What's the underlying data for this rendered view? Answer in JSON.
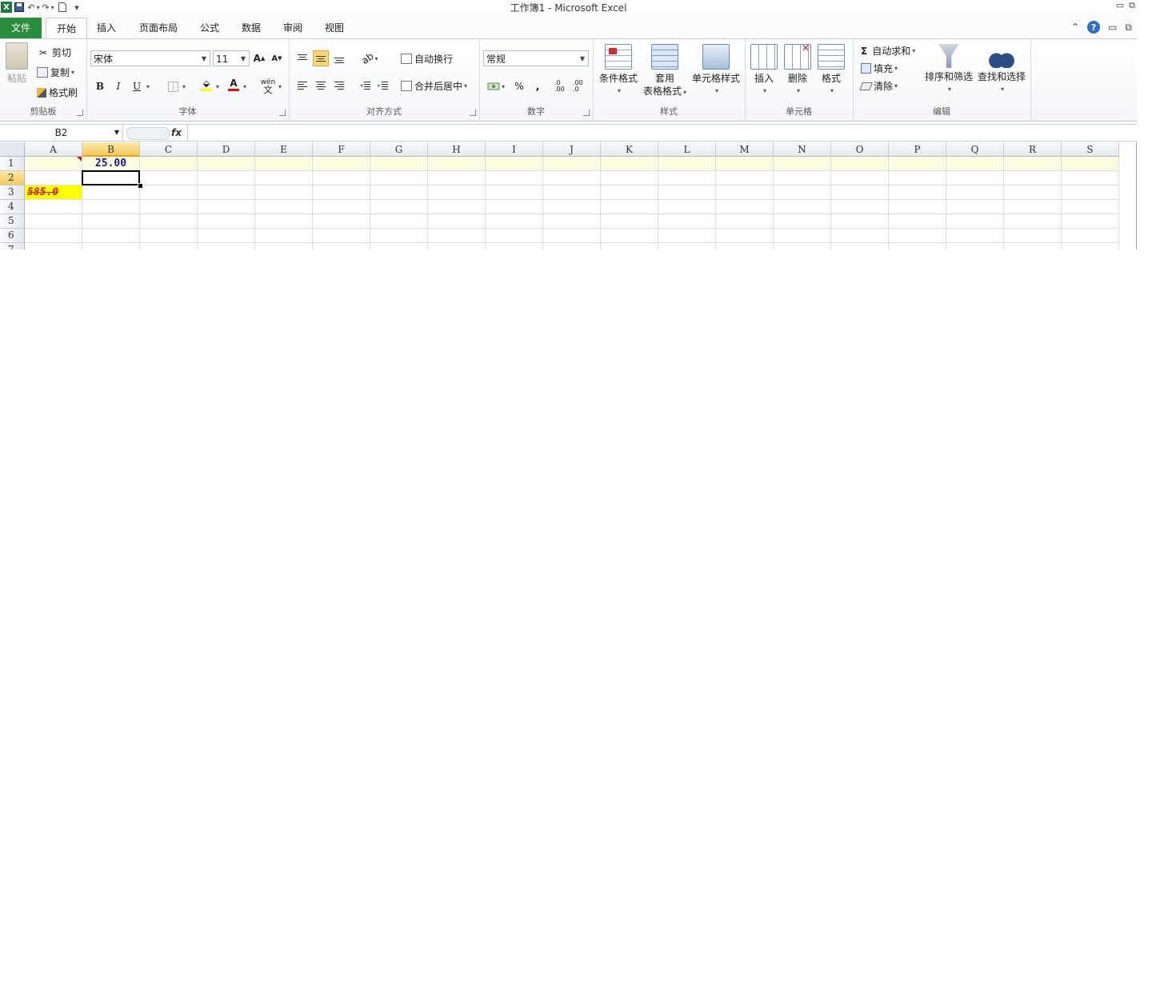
{
  "window": {
    "title": "工作簿1 - Microsoft Excel",
    "app_icon": "excel-icon"
  },
  "tabs": {
    "file": "文件",
    "items": [
      "开始",
      "插入",
      "页面布局",
      "公式",
      "数据",
      "审阅",
      "视图"
    ],
    "active": "开始"
  },
  "ribbon": {
    "clipboard": {
      "label": "剪贴板",
      "paste": "粘贴",
      "cut": "剪切",
      "copy": "复制",
      "format_painter": "格式刷"
    },
    "font": {
      "label": "字体",
      "font_name": "宋体",
      "font_size": "11",
      "bold": "B",
      "italic": "I",
      "underline": "U",
      "grow": "A",
      "shrink": "A",
      "font_color": "A",
      "phonetic": "wén"
    },
    "alignment": {
      "label": "对齐方式",
      "wrap_text": "自动换行",
      "merge_center": "合并后居中"
    },
    "number": {
      "label": "数字",
      "format": "常规",
      "percent": "%",
      "comma": ",",
      "inc_decimal": ".0 .00",
      "dec_decimal": ".00 .0"
    },
    "styles": {
      "label": "样式",
      "conditional": "条件格式",
      "table_line1": "套用",
      "table_line2": "表格格式",
      "cell_styles": "单元格样式"
    },
    "cells": {
      "label": "单元格",
      "insert": "插入",
      "delete": "删除",
      "format": "格式"
    },
    "editing": {
      "label": "编辑",
      "autosum": "自动求和",
      "sigma": "Σ",
      "fill": "填充",
      "clear": "清除",
      "sort_filter": "排序和筛选",
      "find_select": "查找和选择"
    }
  },
  "formula_bar": {
    "name_box": "B2",
    "fx": "fx",
    "content": ""
  },
  "sheet": {
    "columns": [
      "A",
      "B",
      "C",
      "D",
      "E",
      "F",
      "G",
      "H",
      "I",
      "J",
      "K",
      "L",
      "M",
      "N",
      "O",
      "P",
      "Q",
      "R",
      "S"
    ],
    "rows": [
      "1",
      "2",
      "3",
      "4",
      "5",
      "6",
      "7"
    ],
    "selected_column": "B",
    "selected_row": "2",
    "cells": {
      "B1": "25.00",
      "A3": "585.0"
    },
    "colors": {
      "b1_text": "#1a1a8c",
      "a3_fill": "#ffff00",
      "a3_text": "#d41f1f",
      "row1_highlight": "#fdfde2"
    }
  }
}
